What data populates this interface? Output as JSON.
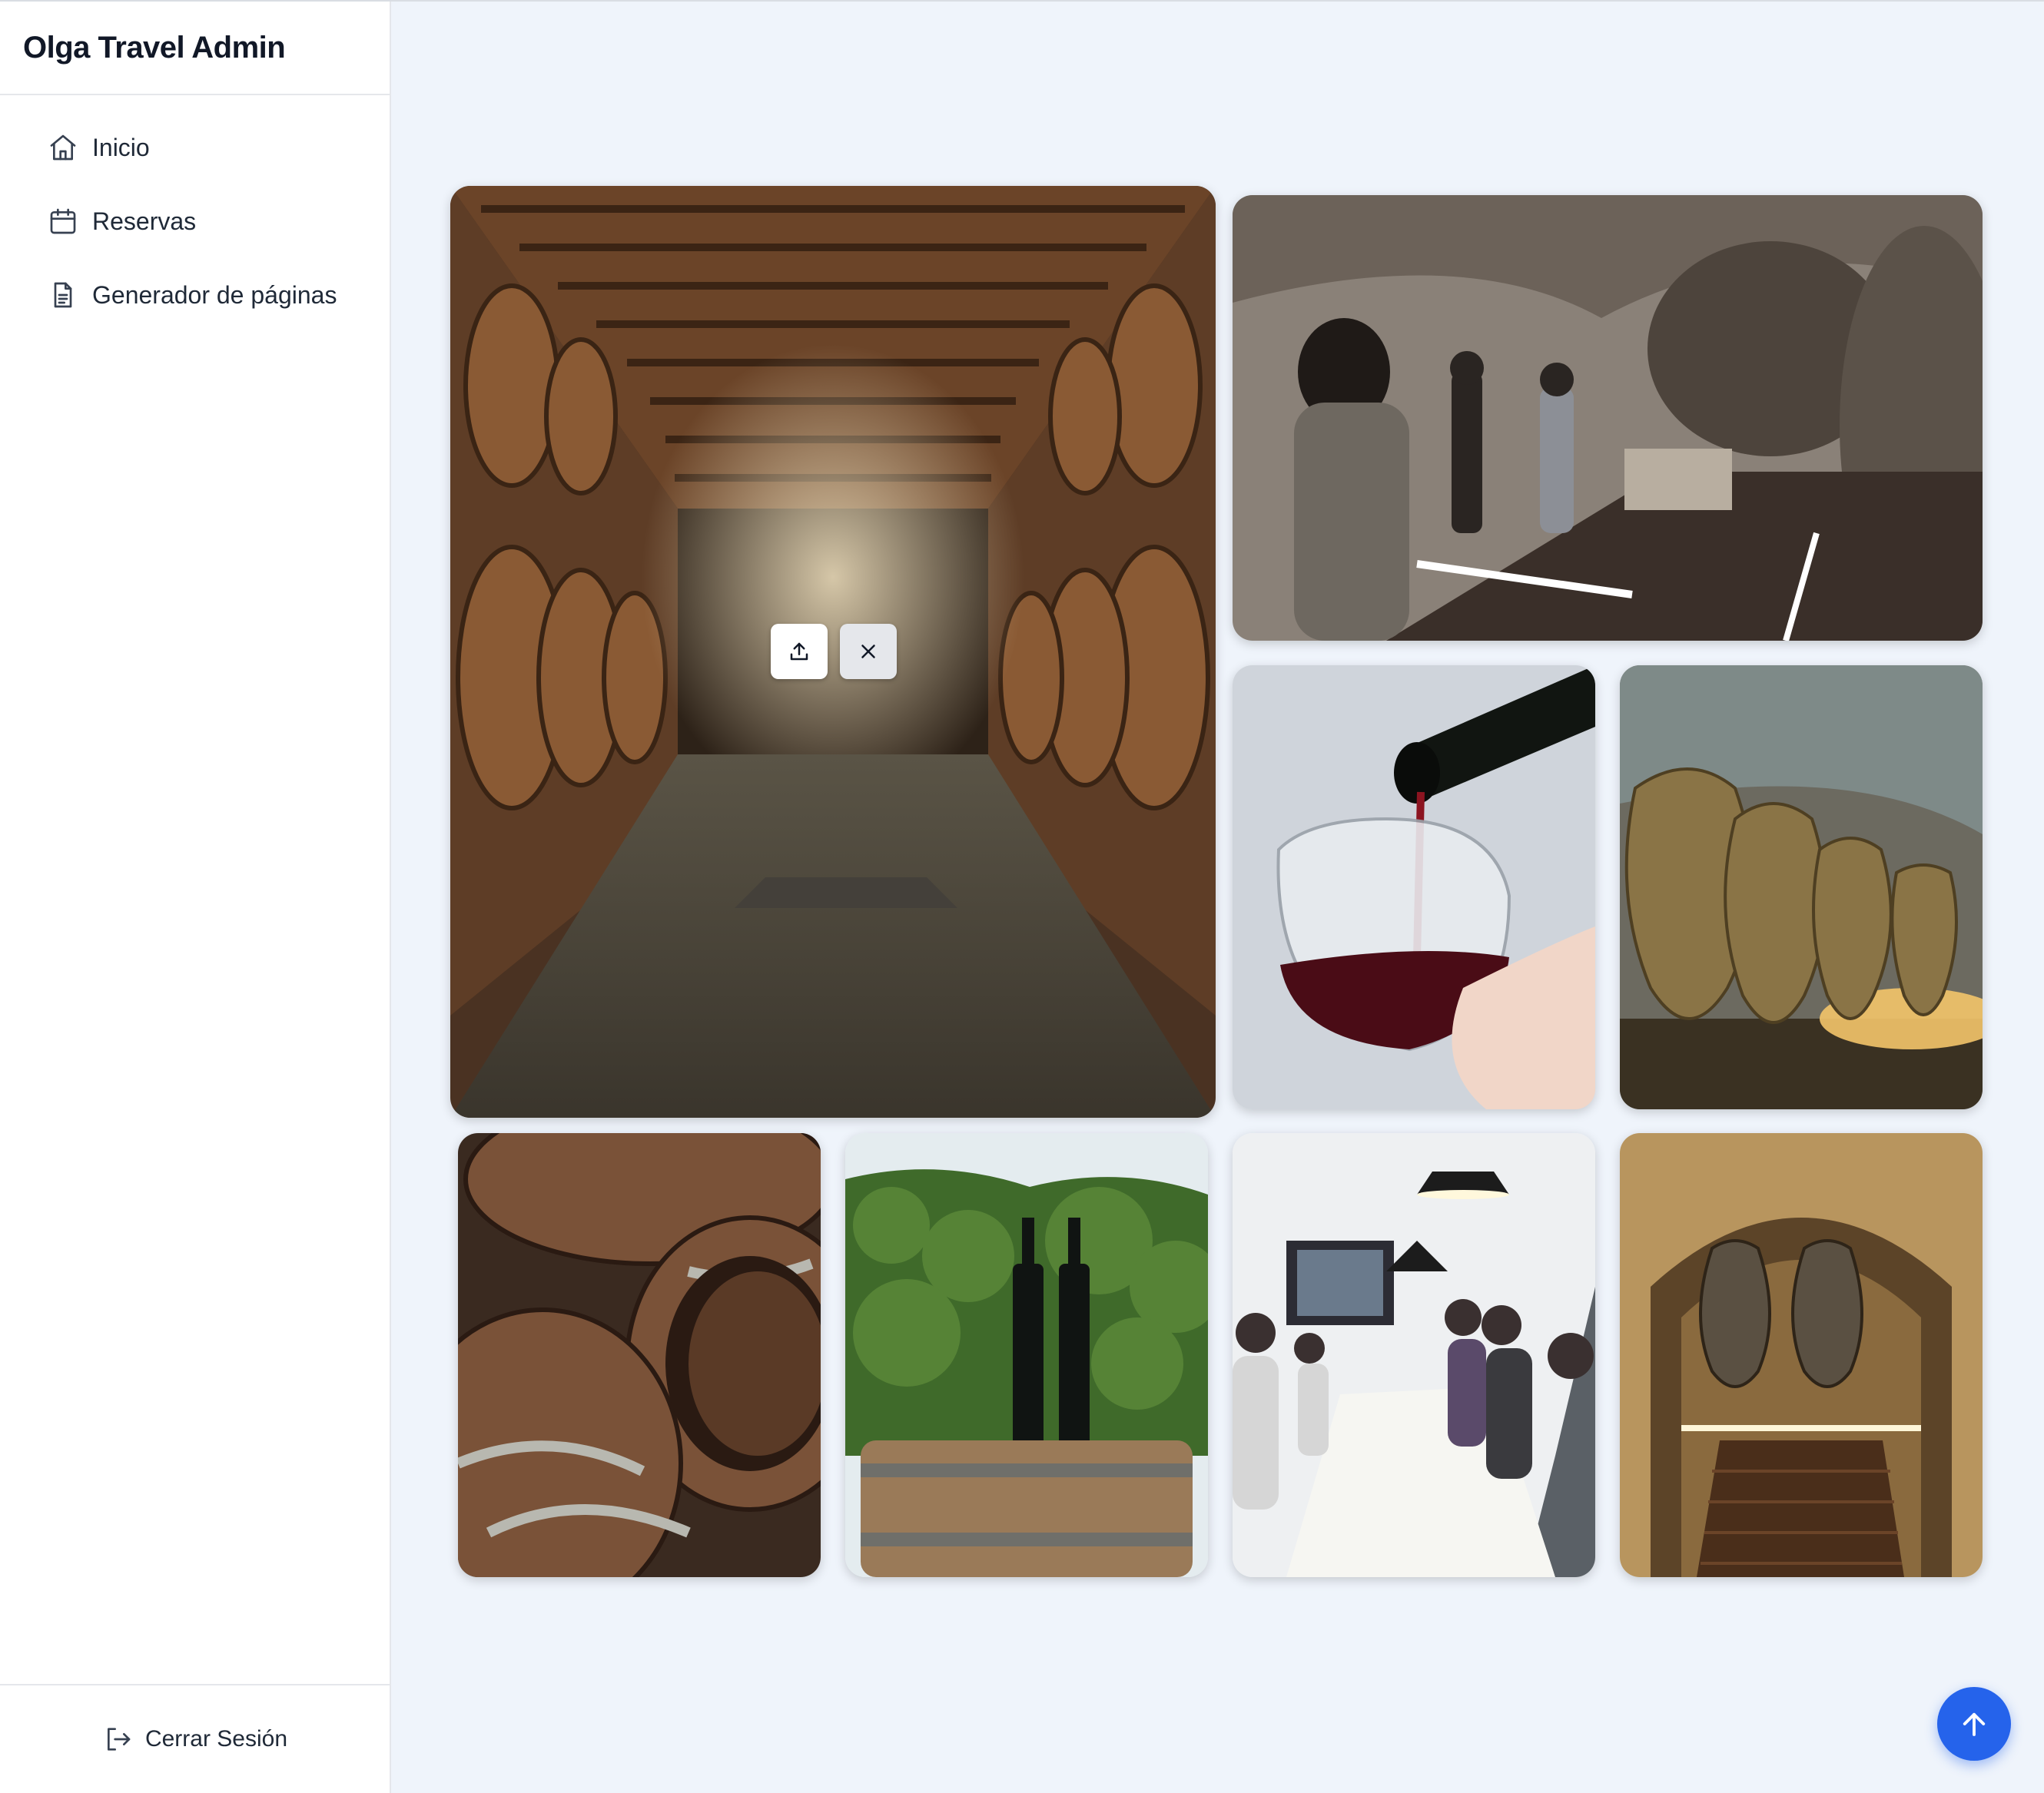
{
  "sidebar": {
    "title": "Olga Travel Admin",
    "items": [
      {
        "label": "Inicio",
        "icon": "home-icon"
      },
      {
        "label": "Reservas",
        "icon": "calendar-icon"
      },
      {
        "label": "Generador de páginas",
        "icon": "document-icon"
      }
    ],
    "logout_label": "Cerrar Sesión"
  },
  "gallery": {
    "photos": [
      {
        "subject": "wine-cellar-barrels"
      },
      {
        "subject": "cave-visitors"
      },
      {
        "subject": "wine-pouring"
      },
      {
        "subject": "clay-amphorae"
      },
      {
        "subject": "wooden-barrels"
      },
      {
        "subject": "bottles-vineyard"
      },
      {
        "subject": "tasting-group"
      },
      {
        "subject": "cave-tunnel"
      }
    ],
    "actions": {
      "upload_icon": "upload-icon",
      "remove_icon": "close-icon"
    }
  },
  "scroll_top": {
    "icon": "arrow-up-icon"
  },
  "colors": {
    "accent": "#2563eb",
    "background": "#eff4fb",
    "sidebar": "#ffffff"
  }
}
